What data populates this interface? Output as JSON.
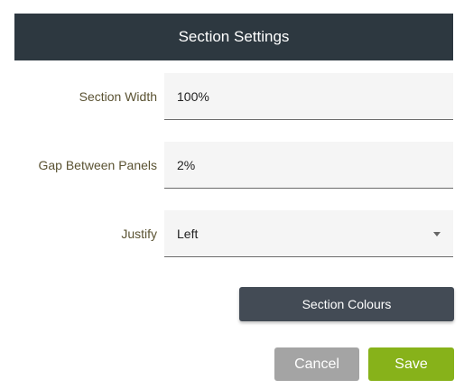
{
  "header": {
    "title": "Section Settings",
    "background": "#2d3840"
  },
  "fields": {
    "section_width": {
      "label": "Section Width",
      "value": "100%"
    },
    "gap_between_panels": {
      "label": "Gap Between Panels",
      "value": "2%"
    },
    "justify": {
      "label": "Justify",
      "value": "Left"
    }
  },
  "buttons": {
    "section_colours": "Section Colours",
    "cancel": "Cancel",
    "save": "Save"
  },
  "colors": {
    "label_text": "#5a5232",
    "colours_button": "#434b55",
    "cancel_button": "#a4a4a4",
    "save_button": "#87b21a"
  },
  "icons": {
    "justify_dropdown": "chevron-down-icon"
  }
}
